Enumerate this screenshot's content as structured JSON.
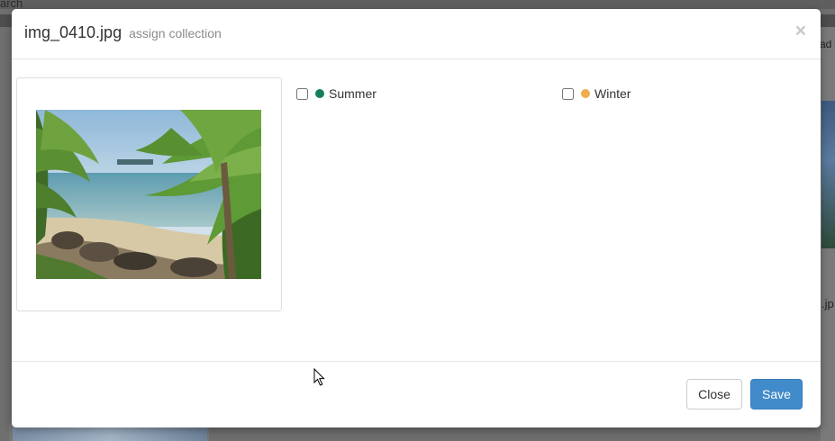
{
  "background": {
    "search_text": "arch",
    "upload_text": "ad",
    "filename_fragment": ".jp"
  },
  "modal": {
    "title": "img_0410.jpg",
    "subtitle": "assign collection",
    "close_symbol": "×"
  },
  "collections": [
    {
      "label": "Summer",
      "color": "#137d5c",
      "checked": false
    },
    {
      "label": "Winter",
      "color": "#f0ad4e",
      "checked": false
    }
  ],
  "footer": {
    "close_label": "Close",
    "save_label": "Save"
  },
  "colors": {
    "primary": "#428bca",
    "summer": "#137d5c",
    "winter": "#f0ad4e"
  }
}
